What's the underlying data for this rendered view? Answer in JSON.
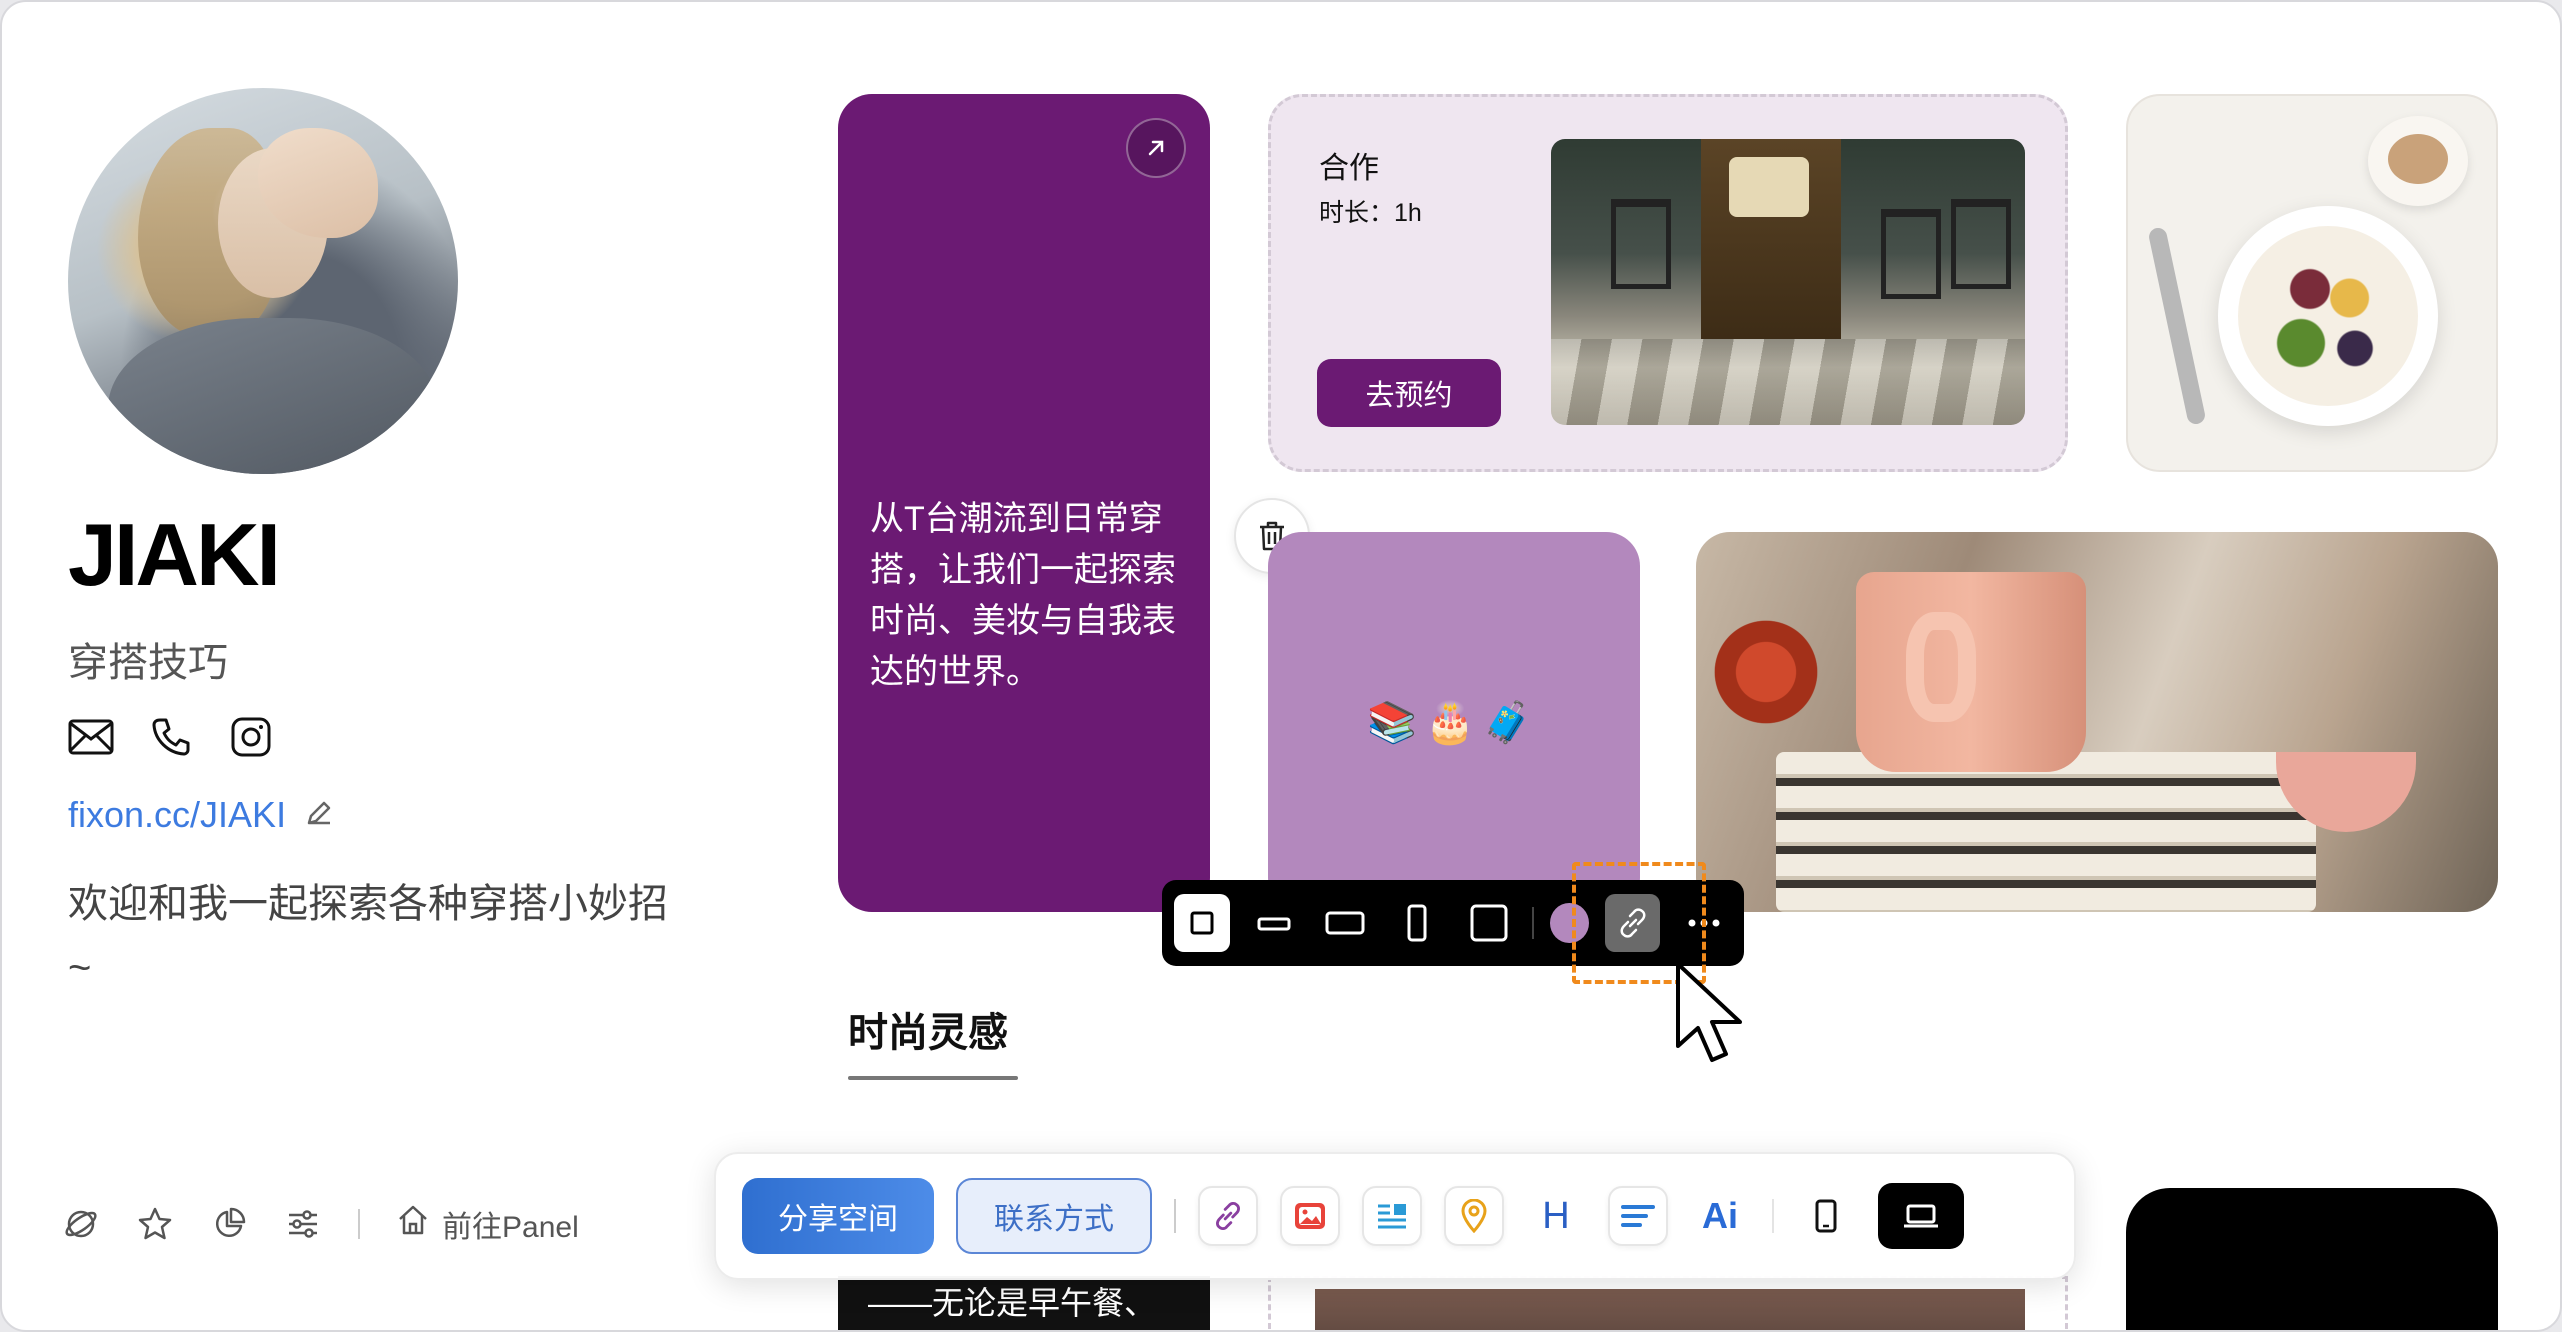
{
  "profile": {
    "name": "JIAKI",
    "subtitle": "穿搭技巧",
    "url": "fixon.cc/JIAKI",
    "bio": "欢迎和我一起探索各种穿搭小妙招~",
    "contacts": [
      "mail-icon",
      "phone-icon",
      "instagram-icon"
    ]
  },
  "bottom_left": {
    "panel_label": "前往Panel"
  },
  "cards": {
    "purple_text": "从T台潮流到日常穿搭，让我们一起探索时尚、美妆与自我表达的世界。",
    "collab_title": "合作",
    "collab_duration": "时长：1h",
    "collab_button": "去预约",
    "emoji_card": "📚🎂🧳",
    "peek_text": "——无论是早午餐、"
  },
  "card_toolbar": {
    "sizes": [
      "square-small",
      "wide-small",
      "wide-medium",
      "tall",
      "square-large"
    ],
    "color": "#b388bd"
  },
  "section": {
    "title": "时尚灵感"
  },
  "bottom_bar": {
    "share_label": "分享空间",
    "contact_label": "联系方式",
    "tools": [
      "link-icon",
      "image-icon",
      "text-icon",
      "map-pin-icon",
      "heading-icon",
      "paragraph-icon",
      "ai-icon"
    ],
    "heading_glyph": "H",
    "ai_glyph": "Ai"
  },
  "colors": {
    "purple_dark": "#6b1a73",
    "purple_light": "#b388bd",
    "accent_blue": "#3d7be0",
    "highlight_orange": "#f08a1c"
  }
}
